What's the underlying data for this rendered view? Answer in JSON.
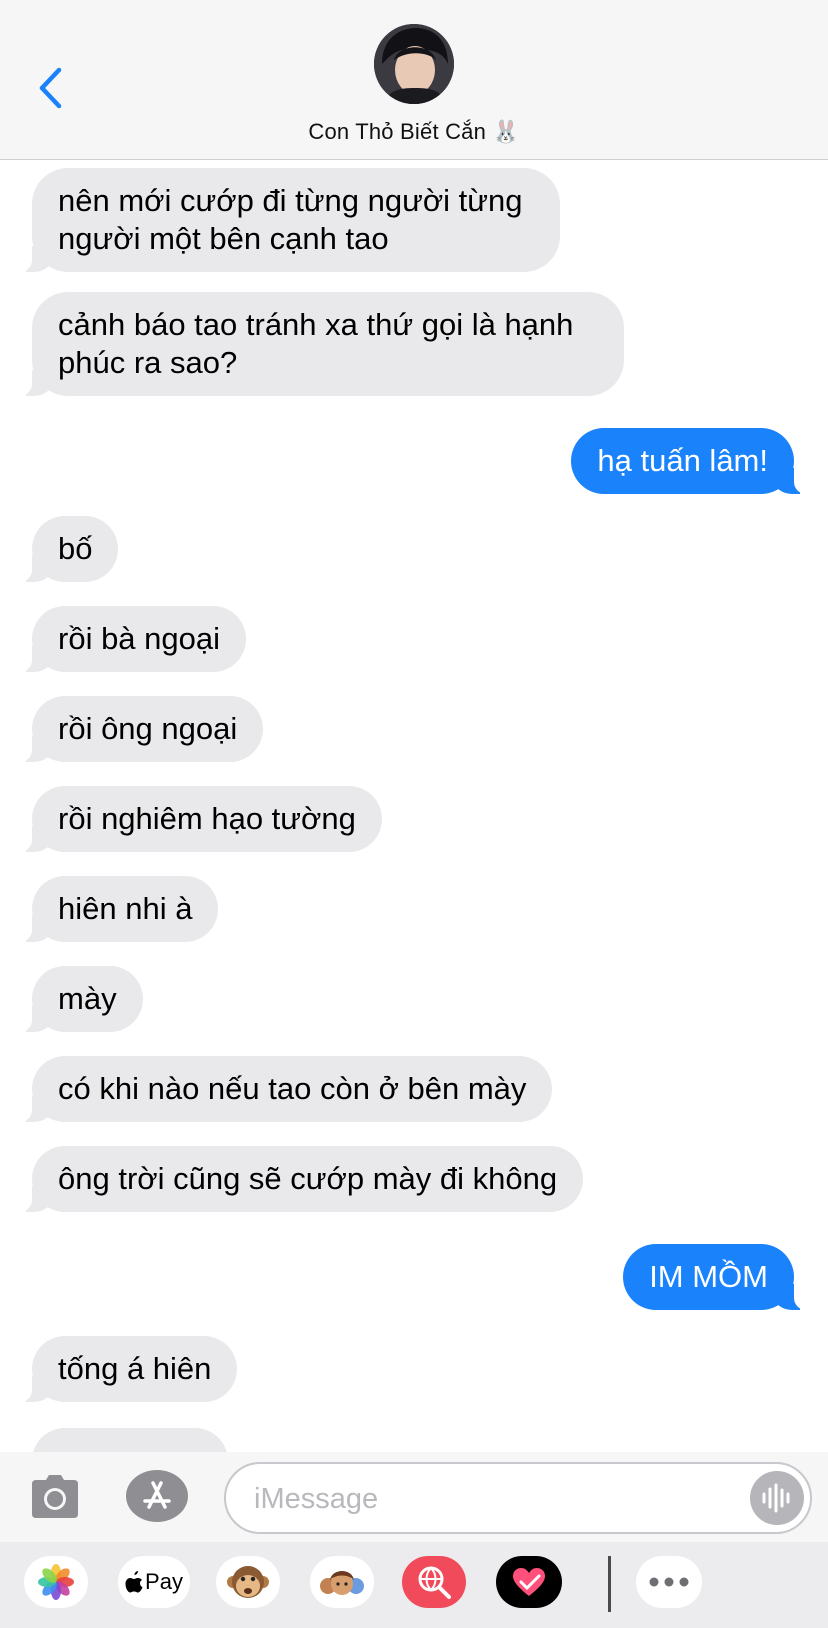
{
  "header": {
    "contact_name": "Con Thỏ Biết Cắn",
    "contact_emoji": "🐰"
  },
  "thread": {
    "messages": [
      {
        "direction": "in",
        "lines": [
          "nên mới cướp đi từng người từng",
          "người một bên cạnh tao"
        ]
      },
      {
        "direction": "in",
        "lines": [
          "cảnh báo tao tránh xa thứ gọi là hạnh",
          "phúc ra sao?"
        ]
      },
      {
        "direction": "out",
        "lines": [
          "hạ tuấn lâm!"
        ]
      },
      {
        "direction": "in",
        "lines": [
          "bố"
        ]
      },
      {
        "direction": "in",
        "lines": [
          "rồi bà ngoại"
        ]
      },
      {
        "direction": "in",
        "lines": [
          "rồi ông ngoại"
        ]
      },
      {
        "direction": "in",
        "lines": [
          "rồi nghiêm hạo tường"
        ]
      },
      {
        "direction": "in",
        "lines": [
          "hiên nhi à"
        ]
      },
      {
        "direction": "in",
        "lines": [
          "mày"
        ]
      },
      {
        "direction": "in",
        "lines": [
          "có khi nào nếu tao còn ở bên mày"
        ]
      },
      {
        "direction": "in",
        "lines": [
          "ông trời cũng sẽ cướp mày đi không"
        ]
      },
      {
        "direction": "out",
        "lines": [
          "IM MỒM"
        ]
      },
      {
        "direction": "in",
        "lines": [
          "tống á hiên"
        ]
      }
    ]
  },
  "composer": {
    "placeholder": "iMessage",
    "value": ""
  },
  "drawer": {
    "apps": [
      {
        "name": "photos-app-icon"
      },
      {
        "name": "apple-pay-app-icon",
        "label": "Pay"
      },
      {
        "name": "animoji-app-icon"
      },
      {
        "name": "memoji-app-icon"
      },
      {
        "name": "search-images-app-icon"
      },
      {
        "name": "digital-touch-app-icon"
      },
      {
        "name": "more-apps-icon"
      }
    ]
  },
  "colors": {
    "accent": "#1a82fb",
    "incoming_bubble": "#e9e9eb",
    "header_bg": "#f6f6f7"
  }
}
